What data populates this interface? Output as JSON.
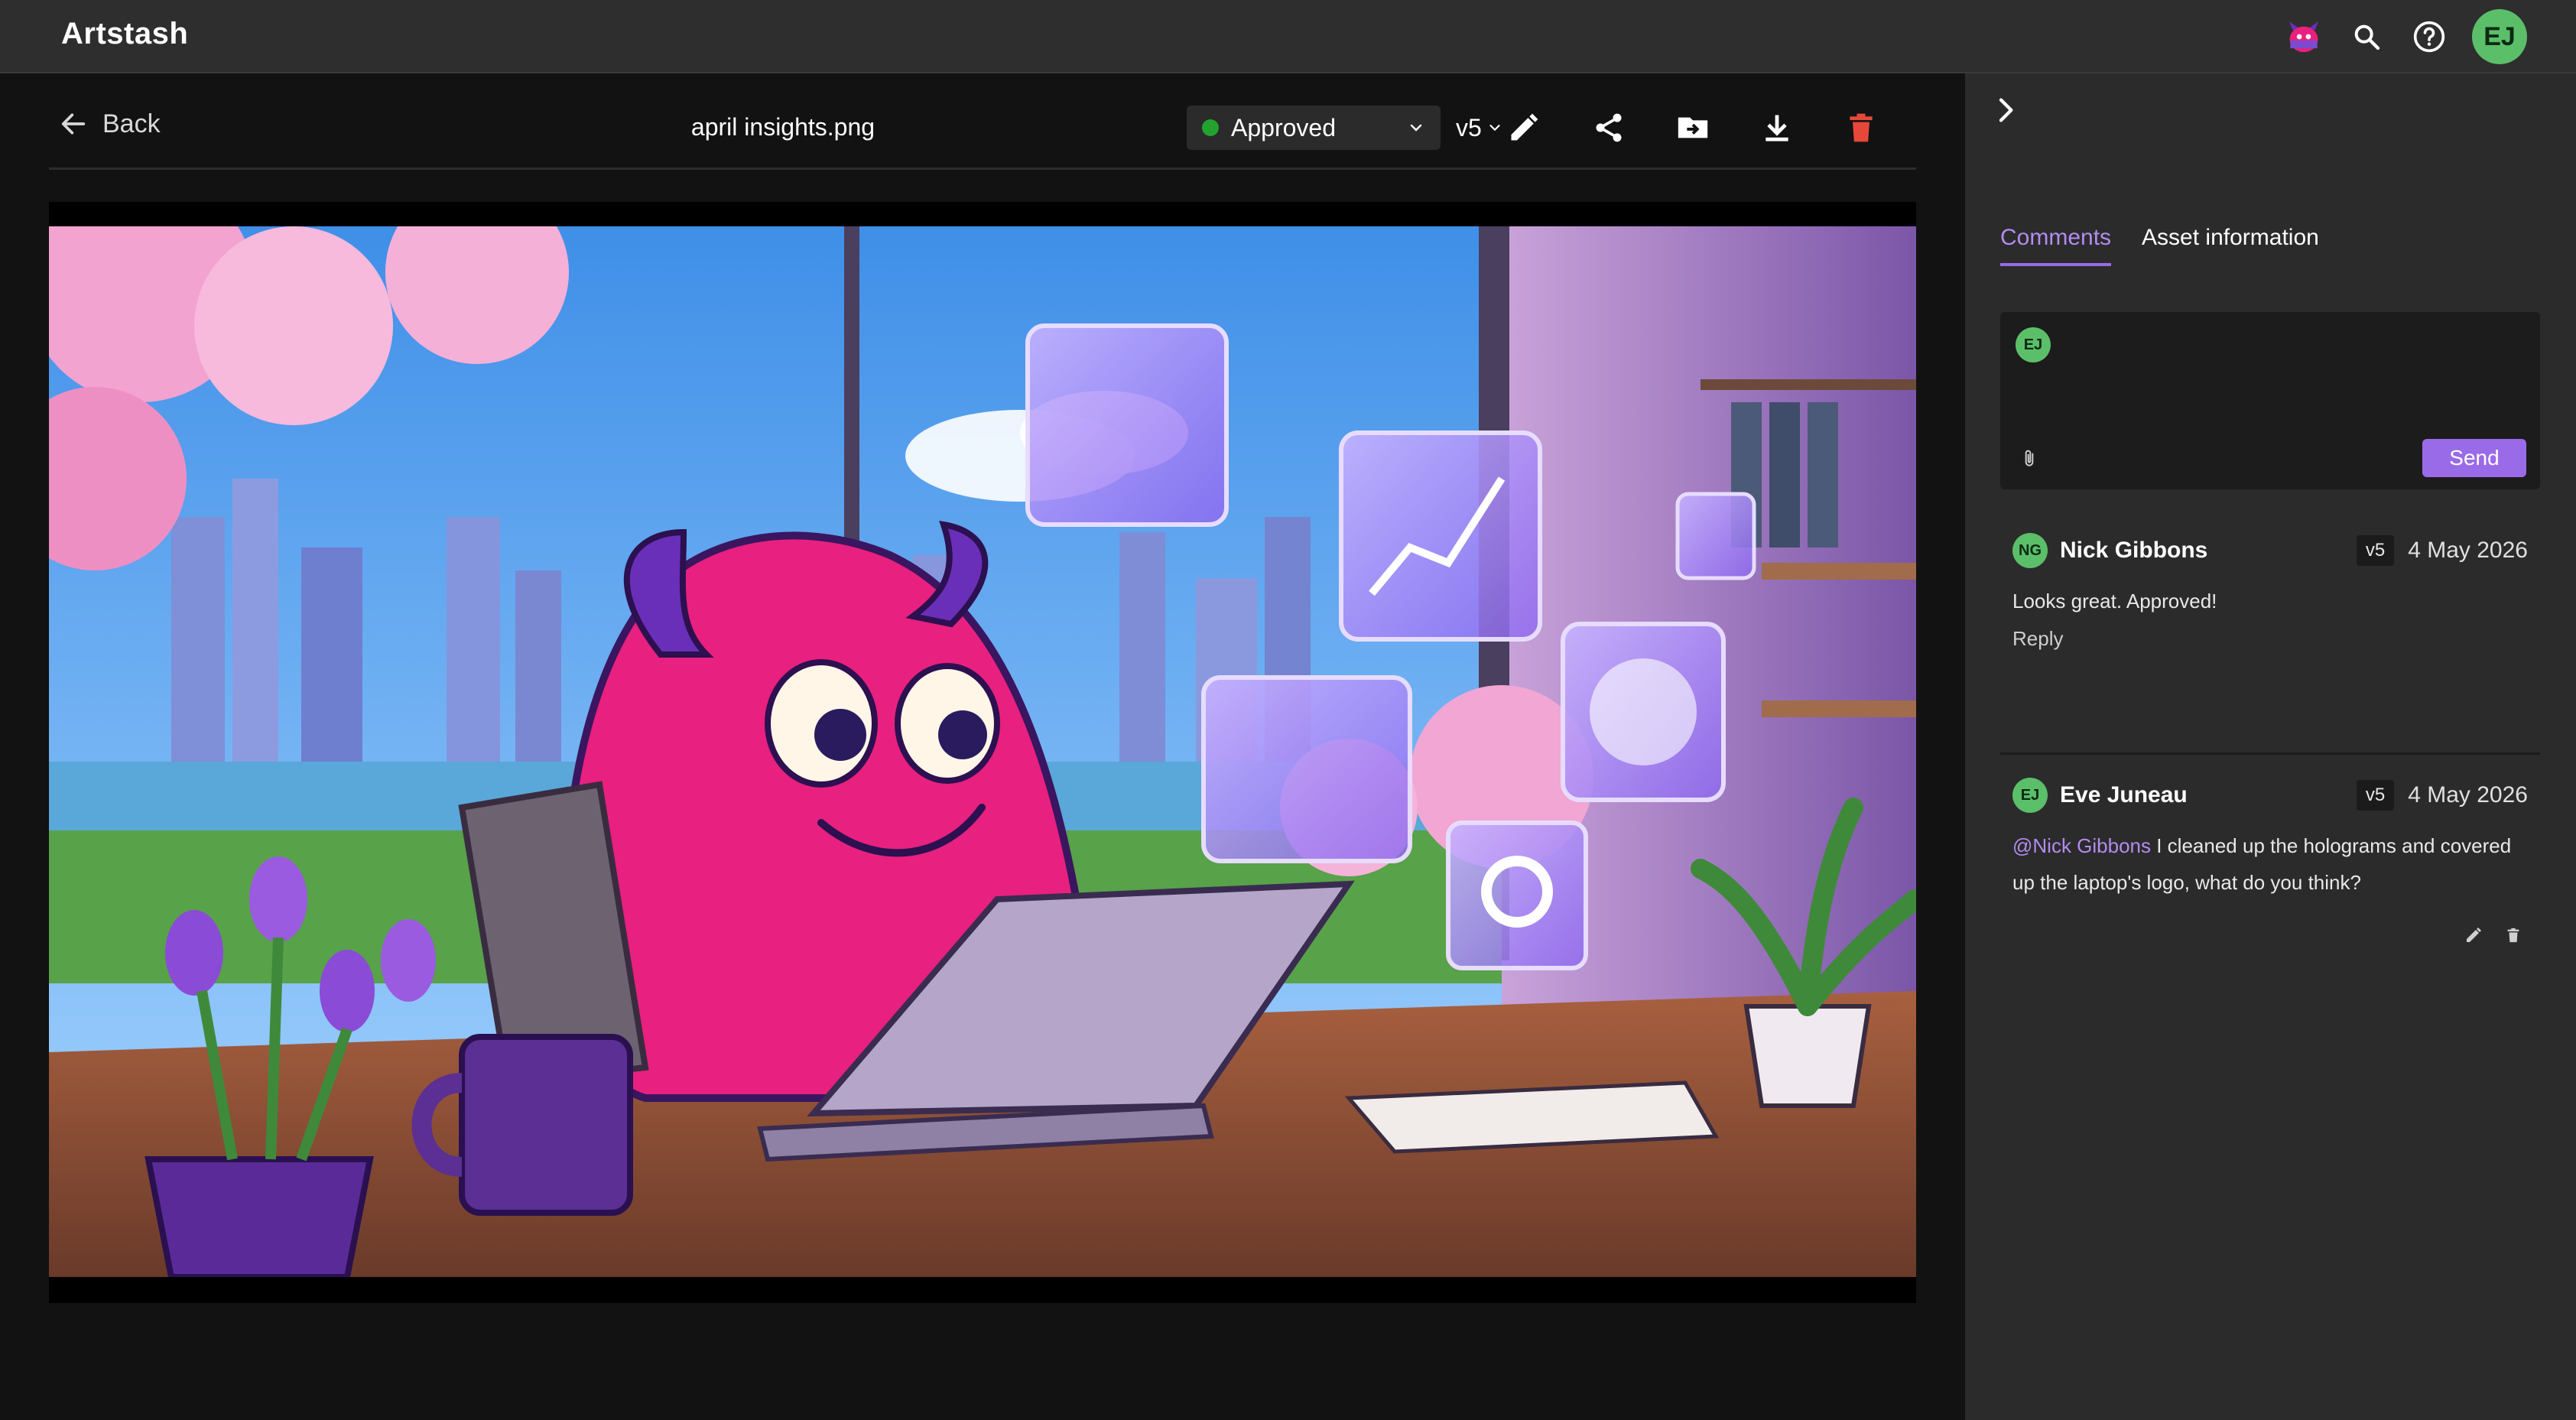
{
  "app": {
    "title": "Artstash"
  },
  "header": {
    "user_initials": "EJ",
    "icons": [
      "app-mascot-icon",
      "search-icon",
      "help-icon"
    ]
  },
  "toolbar": {
    "back_label": "Back",
    "file_name": "april insights.png",
    "status": {
      "label": "Approved",
      "color": "#23a32e"
    },
    "version": "v5",
    "actions": [
      "edit-icon",
      "share-icon",
      "move-to-folder-icon",
      "download-icon",
      "delete-icon"
    ],
    "delete_color": "#e5483b"
  },
  "panel": {
    "tabs": [
      {
        "label": "Comments",
        "active": true
      },
      {
        "label": "Asset information",
        "active": false
      }
    ],
    "composer": {
      "user_initials": "EJ",
      "value": "",
      "send_label": "Send"
    },
    "comments": [
      {
        "initials": "NG",
        "author": "Nick Gibbons",
        "version": "v5",
        "date": "4 May 2026",
        "text": "Looks great. Approved!",
        "reply_label": "Reply"
      },
      {
        "initials": "EJ",
        "author": "Eve Juneau",
        "version": "v5",
        "date": "4 May 2026",
        "mention": "@Nick Gibbons",
        "text": " I cleaned up the holograms and covered up the laptop's logo, what do you think?"
      }
    ]
  },
  "colors": {
    "accent": "#9a6be8",
    "avatar": "#5bbf6a",
    "topbar": "#2e2e2e",
    "panel": "#2b2b2b"
  }
}
